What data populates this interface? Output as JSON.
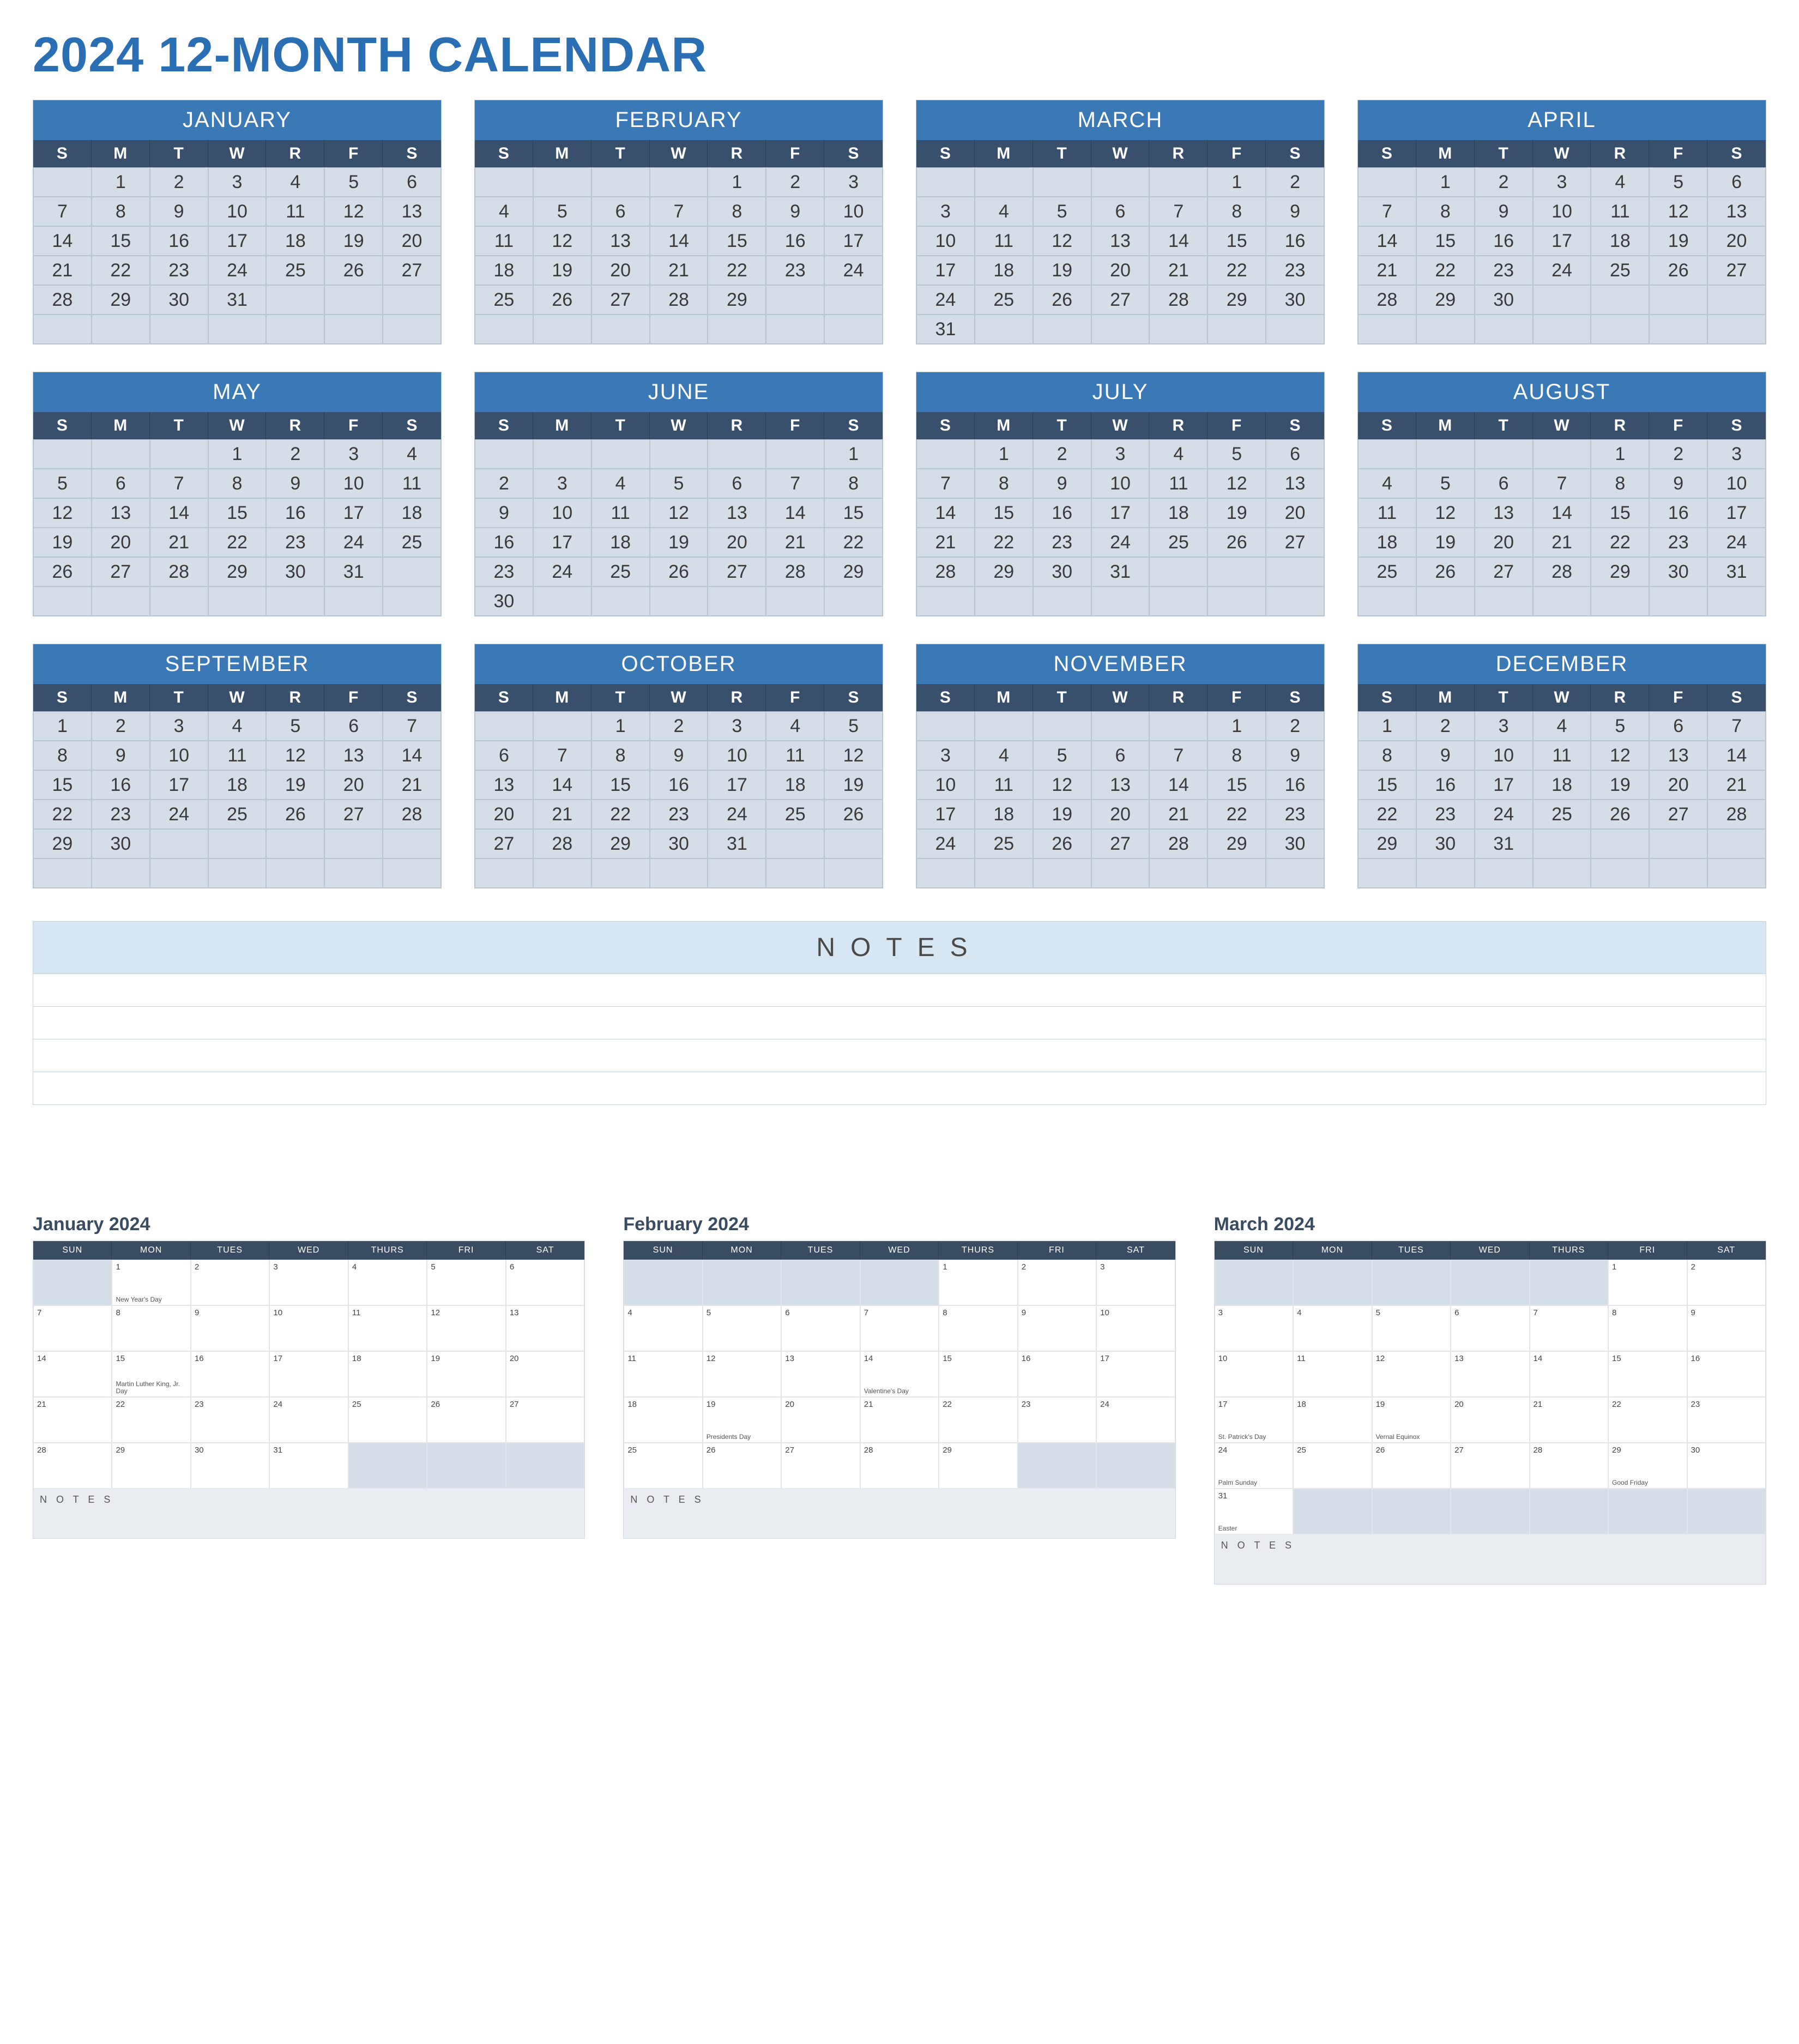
{
  "title": "2024 12-MONTH CALENDAR",
  "dow_short": [
    "S",
    "M",
    "T",
    "W",
    "R",
    "F",
    "S"
  ],
  "months": [
    {
      "name": "JANUARY",
      "start": 1,
      "days": 31
    },
    {
      "name": "FEBRUARY",
      "start": 4,
      "days": 29
    },
    {
      "name": "MARCH",
      "start": 5,
      "days": 31
    },
    {
      "name": "APRIL",
      "start": 1,
      "days": 30
    },
    {
      "name": "MAY",
      "start": 3,
      "days": 31
    },
    {
      "name": "JUNE",
      "start": 6,
      "days": 30
    },
    {
      "name": "JULY",
      "start": 1,
      "days": 31
    },
    {
      "name": "AUGUST",
      "start": 4,
      "days": 31
    },
    {
      "name": "SEPTEMBER",
      "start": 0,
      "days": 30
    },
    {
      "name": "OCTOBER",
      "start": 2,
      "days": 31
    },
    {
      "name": "NOVEMBER",
      "start": 5,
      "days": 30
    },
    {
      "name": "DECEMBER",
      "start": 0,
      "days": 31
    }
  ],
  "notes_label": "NOTES",
  "note_line_count": 4,
  "monthly_dow": [
    "SUN",
    "MON",
    "TUES",
    "WED",
    "THURS",
    "FRI",
    "SAT"
  ],
  "monthly_notes_label": "N O T E S",
  "monthly": [
    {
      "title": "January 2024",
      "start": 1,
      "days": 31,
      "trailing_gray": 3,
      "events": {
        "1": "New Year's Day",
        "15": "Martin Luther King, Jr. Day"
      }
    },
    {
      "title": "February 2024",
      "start": 4,
      "days": 29,
      "trailing_gray": 2,
      "events": {
        "14": "Valentine's Day",
        "19": "Presidents Day"
      }
    },
    {
      "title": "March 2024",
      "start": 5,
      "days": 31,
      "events": {
        "17": "St. Patrick's Day",
        "19": "Vernal Equinox",
        "24": "Palm Sunday",
        "29": "Good Friday",
        "31": "Easter"
      }
    }
  ]
}
